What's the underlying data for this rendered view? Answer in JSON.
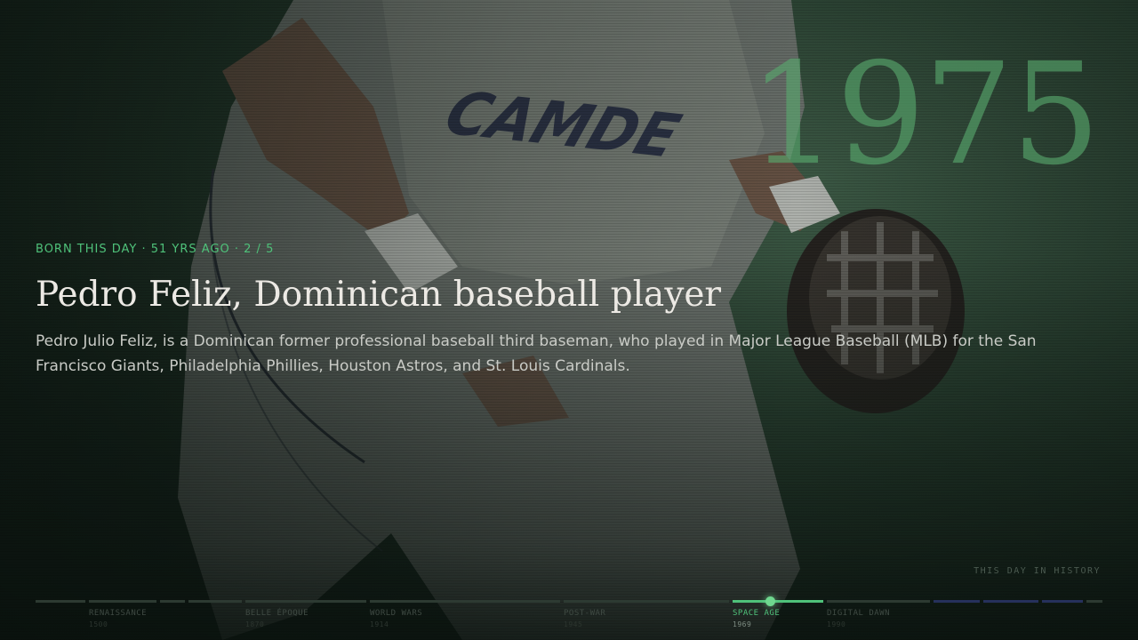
{
  "hero": {
    "year": "1975",
    "eyebrow": "BORN THIS DAY · 51 YRS AGO · 2 / 5",
    "title": "Pedro Feliz, Dominican baseball player",
    "description": "Pedro Julio Feliz, is a Dominican former professional baseball third baseman, who played in Major League Baseball (MLB) for the San Francisco Giants, Philadelphia Phillies, Houston Astros, and St. Louis Cardinals.",
    "accent_color": "#4fc27a"
  },
  "brand": {
    "label": "THIS DAY IN HISTORY"
  },
  "timeline": {
    "eras": [
      {
        "label": "RENAISSANCE",
        "year": "1500"
      },
      {
        "label": "BELLE ÉPOQUE",
        "year": "1870"
      },
      {
        "label": "WORLD WARS",
        "year": "1914"
      },
      {
        "label": "POST-WAR",
        "year": "1945"
      },
      {
        "label": "SPACE AGE",
        "year": "1969",
        "active": true
      },
      {
        "label": "DIGITAL DAWN",
        "year": "1990"
      }
    ],
    "current_position": 0.69
  }
}
